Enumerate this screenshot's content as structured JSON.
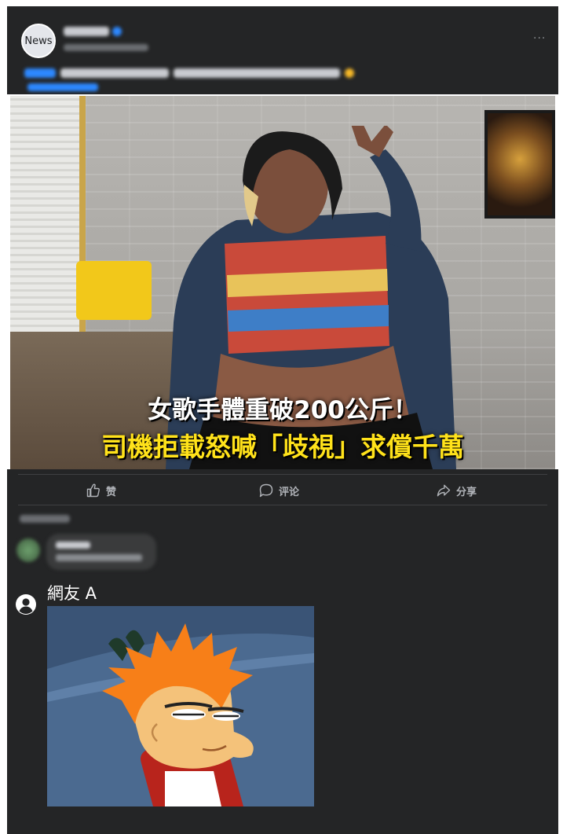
{
  "post": {
    "avatar_label": "News",
    "page_name": "",
    "timestamp": "",
    "caption": "",
    "more_icon": "more-horizontal-icon",
    "image": {
      "headline_line1": "女歌手體重破200公斤！",
      "headline_line2": "司機拒載怒喊「歧視」求償千萬"
    }
  },
  "actions": {
    "like_label": "赞",
    "comment_label": "评论",
    "share_label": "分享",
    "like_icon": "thumbs-up-icon",
    "comment_icon": "comment-bubble-icon",
    "share_icon": "share-arrow-icon"
  },
  "reply": {
    "user_icon": "user-avatar-icon",
    "user_name": "網友 A",
    "meme_image": "squinting-cartoon-character"
  },
  "colors": {
    "panel_background": "#242526",
    "action_text": "#b0b3b8",
    "headline_white": "#ffffff",
    "headline_yellow": "#ffe21a",
    "link_blue": "#2d88ff"
  }
}
